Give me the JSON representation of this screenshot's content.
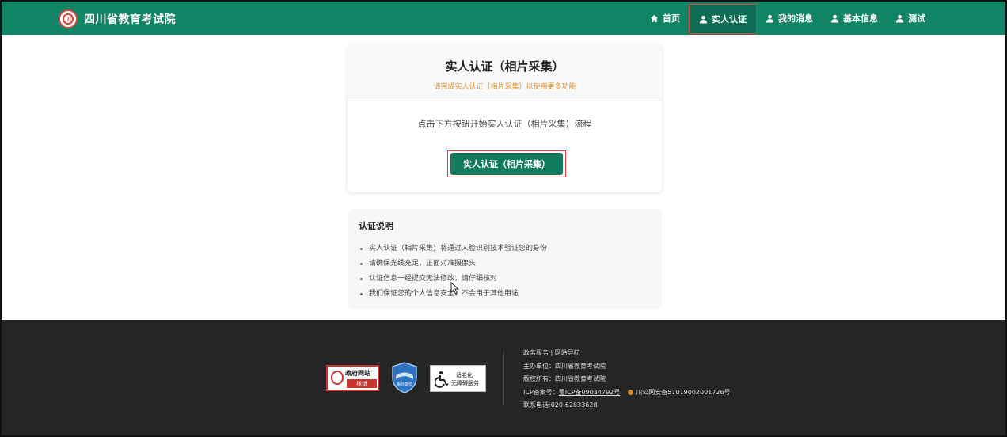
{
  "header": {
    "site_title": "四川省教育考试院",
    "nav": [
      {
        "label": "首页",
        "icon": "home-icon"
      },
      {
        "label": "实人认证",
        "icon": "user-icon",
        "active": true
      },
      {
        "label": "我的消息",
        "icon": "user-icon"
      },
      {
        "label": "基本信息",
        "icon": "user-icon"
      },
      {
        "label": "测试",
        "icon": "user-icon"
      }
    ]
  },
  "card": {
    "title": "实人认证（相片采集）",
    "subtitle": "请完成实人认证（相片采集）以使用更多功能",
    "description": "点击下方按钮开始实人认证（相片采集）流程",
    "button_label": "实人认证（相片采集）"
  },
  "notes": {
    "title": "认证说明",
    "items": [
      "实人认证（相片采集）将通过人脸识别技术验证您的身份",
      "请确保光线充足，正面对准摄像头",
      "认证信息一经提交无法修改，请仔细核对",
      "我们保证您的个人信息安全，不会用于其他用途"
    ]
  },
  "footer": {
    "badge_gov_top": "政府网站",
    "badge_gov_bottom": "找错",
    "badge_unit": "事业单位",
    "badge_access_line1": "适老化",
    "badge_access_line2": "无障碍服务",
    "service_links": "政务服务 | 网站导航",
    "host": "主办单位：四川省教育考试院",
    "copyright": "版权所有：四川省教育考试院",
    "icp_label": "ICP备案号：",
    "icp_number": "蜀ICP备09034792号",
    "police_record": "川公网安备51019002001726号",
    "phone": "联系电话:020-62833628"
  },
  "colors": {
    "brand_green": "#128466",
    "button_green": "#137a5e",
    "subtitle_orange": "#e4922b",
    "highlight_red": "#e03a3a"
  }
}
